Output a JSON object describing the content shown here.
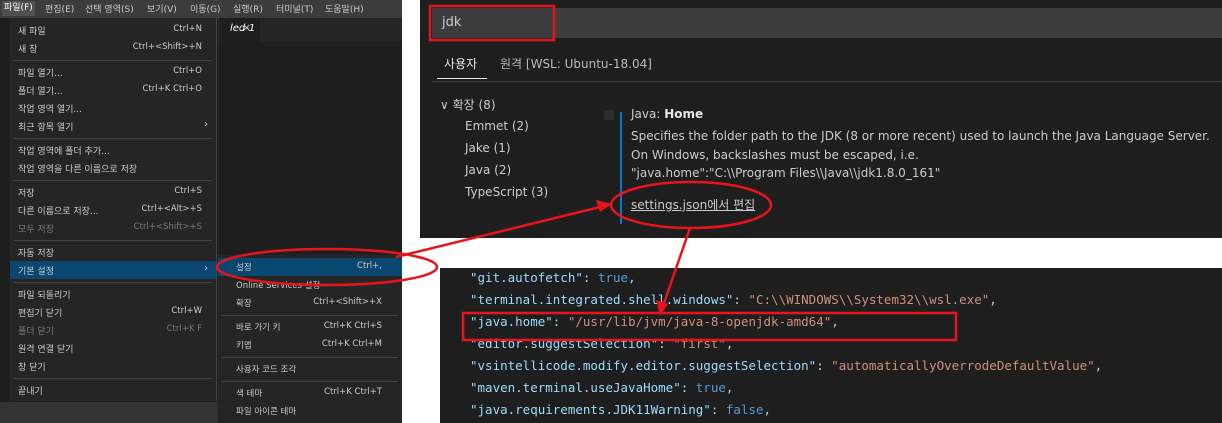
{
  "menubar": {
    "items": [
      "파일(F)",
      "편집(E)",
      "선택 영역(S)",
      "보기(V)",
      "이동(G)",
      "실행(R)",
      "터미널(T)",
      "도움말(H)"
    ]
  },
  "editor_tab": {
    "label": "led-1",
    "close": "×"
  },
  "file_menu": {
    "items": [
      {
        "label": "새 파일",
        "shortcut": "Ctrl+N"
      },
      {
        "label": "새 창",
        "shortcut": "Ctrl+<Shift>+N"
      },
      {
        "label": "파일 열기...",
        "shortcut": "Ctrl+O"
      },
      {
        "label": "폴더 열기...",
        "shortcut": "Ctrl+K Ctrl+O"
      },
      {
        "label": "작업 영역 열기...",
        "shortcut": ""
      },
      {
        "label": "최근 항목 열기",
        "shortcut": ""
      },
      {
        "label": "작업 영역에 폴더 추가...",
        "shortcut": ""
      },
      {
        "label": "작업 영역을 다른 이름으로 저장",
        "shortcut": ""
      },
      {
        "label": "저장",
        "shortcut": "Ctrl+S"
      },
      {
        "label": "다른 이름으로 저장...",
        "shortcut": "Ctrl+<Alt>+S"
      },
      {
        "label": "모두 저장",
        "shortcut": "Ctrl+<Shift>+S"
      },
      {
        "label": "자동 저장",
        "shortcut": ""
      },
      {
        "label": "기본 설정",
        "shortcut": ""
      },
      {
        "label": "파일 되돌리기",
        "shortcut": ""
      },
      {
        "label": "편집기 닫기",
        "shortcut": "Ctrl+W"
      },
      {
        "label": "폴더 닫기",
        "shortcut": "Ctrl+K F"
      },
      {
        "label": "원격 연결 닫기",
        "shortcut": ""
      },
      {
        "label": "창 닫기",
        "shortcut": ""
      },
      {
        "label": "끝내기",
        "shortcut": ""
      }
    ]
  },
  "preferences_submenu": {
    "items": [
      {
        "label": "설정",
        "shortcut": "Ctrl+,"
      },
      {
        "label": "Online Services 설정",
        "shortcut": ""
      },
      {
        "label": "확장",
        "shortcut": "Ctrl+<Shift>+X"
      },
      {
        "label": "바로 가기 키",
        "shortcut": "Ctrl+K Ctrl+S"
      },
      {
        "label": "키맵",
        "shortcut": "Ctrl+K Ctrl+M"
      },
      {
        "label": "사용자 코드 조각",
        "shortcut": ""
      },
      {
        "label": "색 테마",
        "shortcut": "Ctrl+K Ctrl+T"
      },
      {
        "label": "파일 아이콘 테마",
        "shortcut": ""
      }
    ]
  },
  "settings": {
    "search_value": "jdk",
    "tab_user": "사용자",
    "tab_remote": "원격 [WSL: Ubuntu-18.04]",
    "tree": {
      "group": "확장 (8)",
      "items": [
        "Emmet (2)",
        "Jake (1)",
        "Java (2)",
        "TypeScript (3)"
      ]
    },
    "setting": {
      "category": "Java: ",
      "name": "Home",
      "description": [
        "Specifies the folder path to the JDK (8 or more recent) used to launch the Java Language Server.",
        "On Windows, backslashes must be escaped, i.e.",
        "\"java.home\":\"C:\\\\Program Files\\\\Java\\\\jdk1.8.0_161\""
      ],
      "edit_link": "settings.json에서 편집"
    }
  },
  "settings_json": {
    "lines": [
      {
        "key": "\"git.autofetch\"",
        "value": "true",
        "vtype": "bool"
      },
      {
        "key": "\"terminal.integrated.shell.windows\"",
        "value": "\"C:\\\\WINDOWS\\\\System32\\\\wsl.exe\"",
        "vtype": "string"
      },
      {
        "key": "\"java.home\"",
        "value": "\"/usr/lib/jvm/java-8-openjdk-amd64\"",
        "vtype": "string"
      },
      {
        "key": "\"editor.suggestSelection\"",
        "value": "\"first\"",
        "vtype": "string"
      },
      {
        "key": "\"vsintellicode.modify.editor.suggestSelection\"",
        "value": "\"automaticallyOverrodeDefaultValue\"",
        "vtype": "string"
      },
      {
        "key": "\"maven.terminal.useJavaHome\"",
        "value": "true",
        "vtype": "bool"
      },
      {
        "key": "\"java.requirements.JDK11Warning\"",
        "value": "false",
        "vtype": "bool"
      }
    ]
  },
  "colors": {
    "annotation": "#e8141c",
    "accent": "#007acc",
    "menu_highlight": "#094771"
  }
}
